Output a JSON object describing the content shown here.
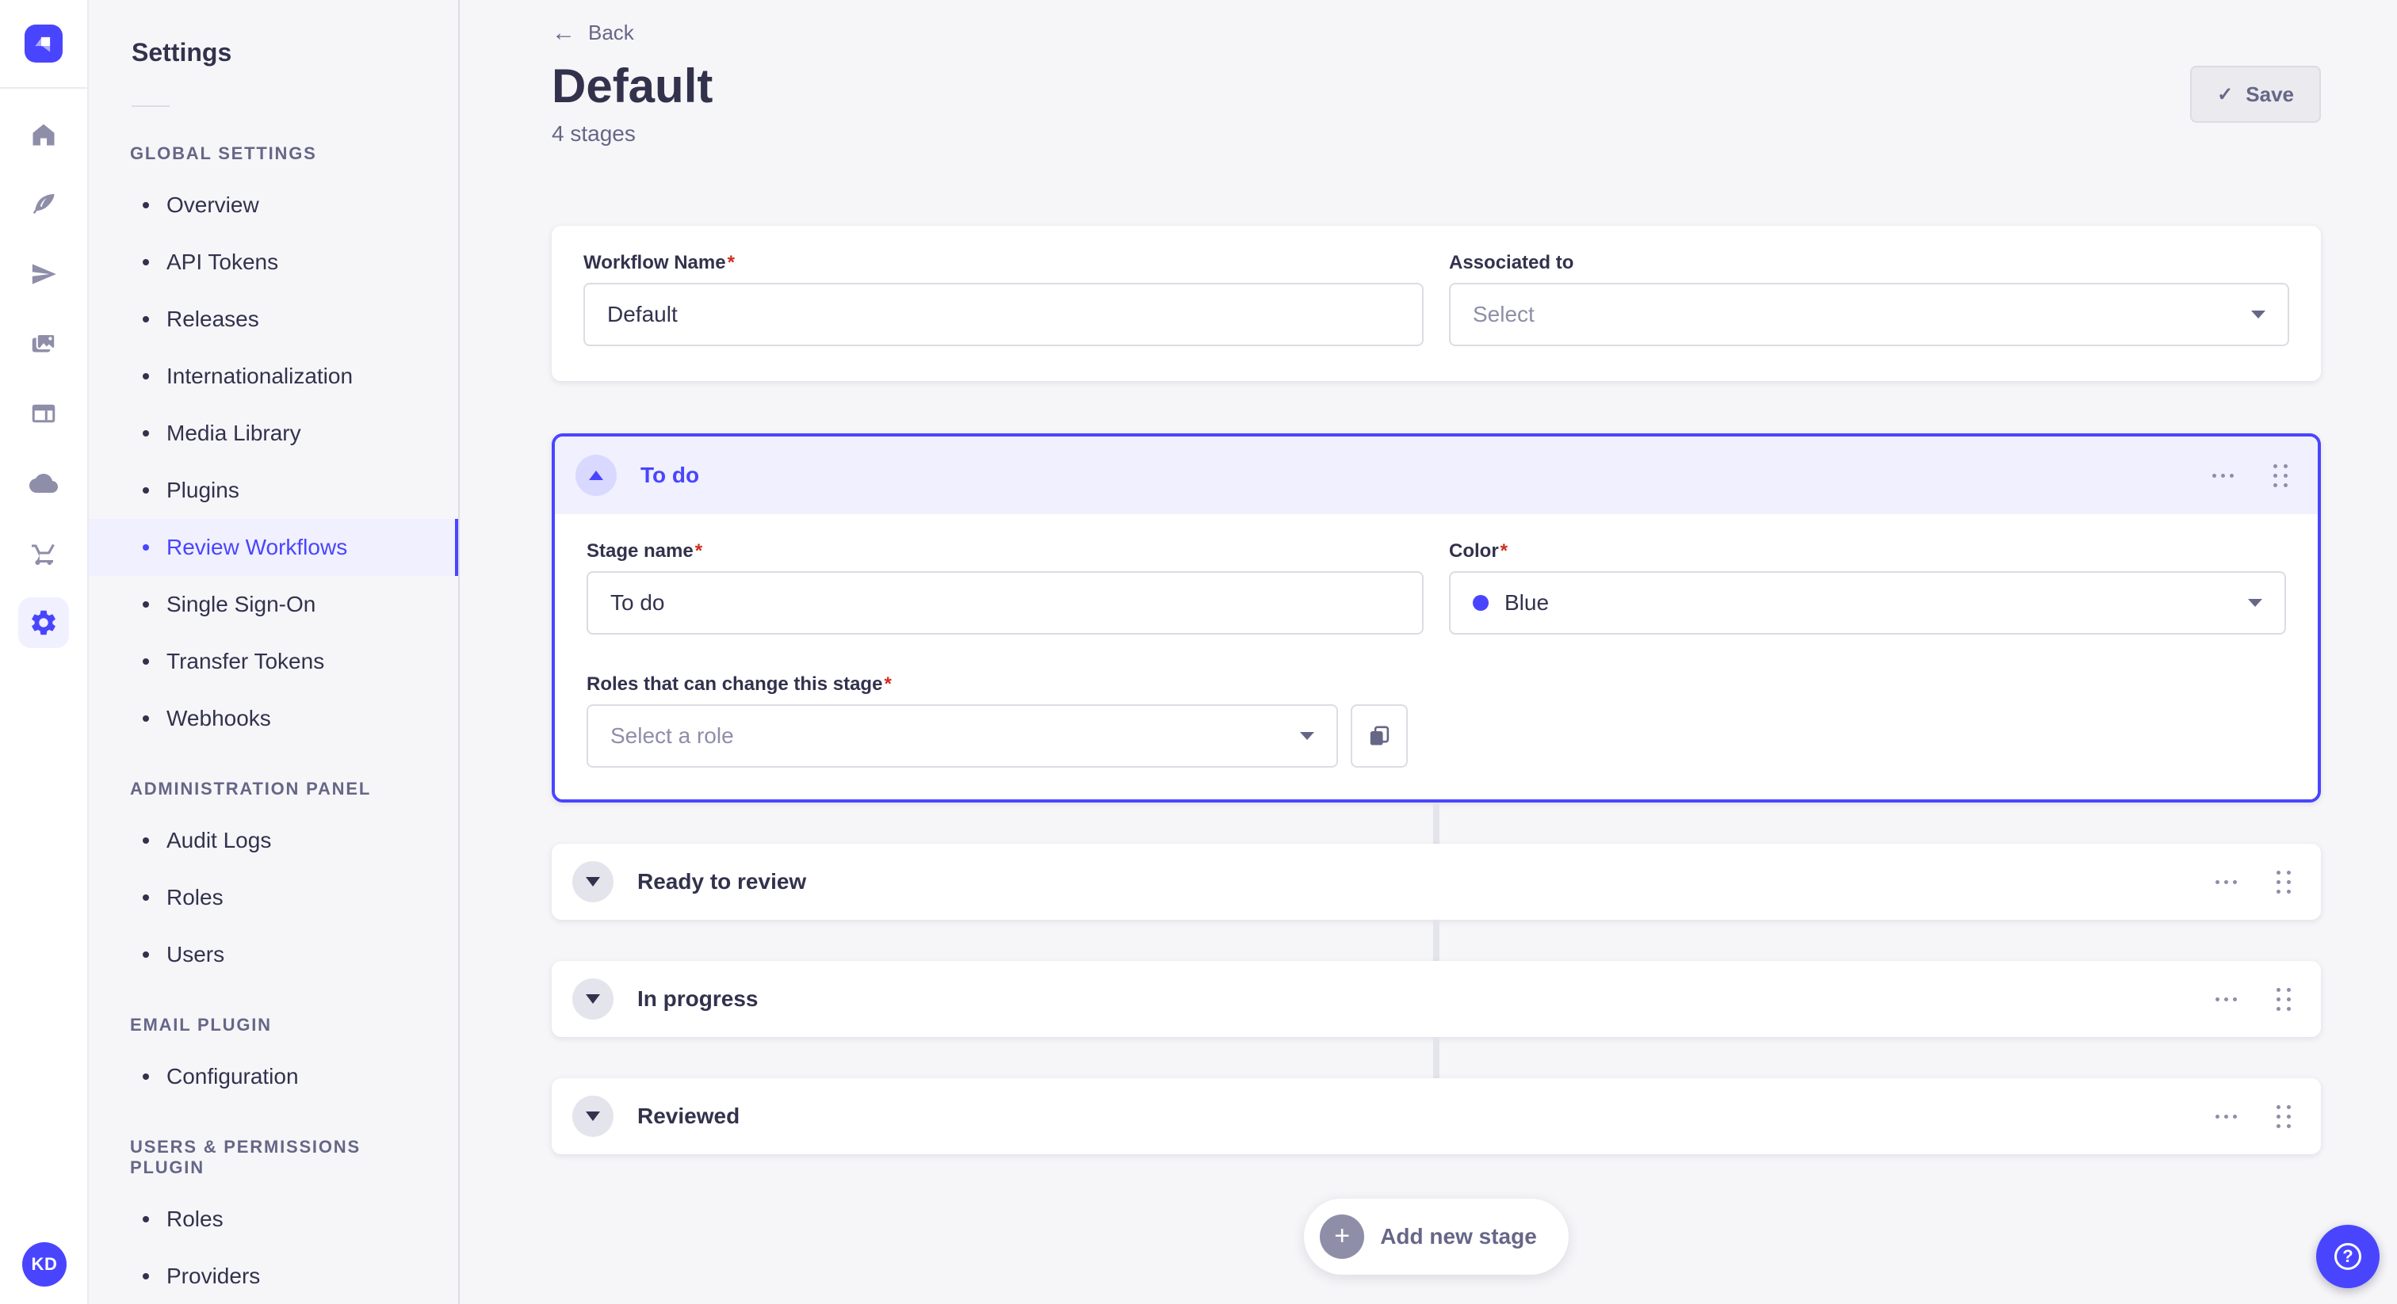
{
  "rail": {
    "icons": [
      "home",
      "content-manager",
      "deploy",
      "media-library",
      "content-type-builder",
      "cloud",
      "marketplace",
      "settings"
    ],
    "active_icon": "settings",
    "avatar_initials": "KD"
  },
  "sidebar": {
    "title": "Settings",
    "sections": [
      {
        "label": "GLOBAL SETTINGS",
        "items": [
          {
            "label": "Overview"
          },
          {
            "label": "API Tokens"
          },
          {
            "label": "Releases"
          },
          {
            "label": "Internationalization"
          },
          {
            "label": "Media Library"
          },
          {
            "label": "Plugins"
          },
          {
            "label": "Review Workflows",
            "active": true
          },
          {
            "label": "Single Sign-On"
          },
          {
            "label": "Transfer Tokens"
          },
          {
            "label": "Webhooks"
          }
        ]
      },
      {
        "label": "ADMINISTRATION PANEL",
        "items": [
          {
            "label": "Audit Logs"
          },
          {
            "label": "Roles"
          },
          {
            "label": "Users"
          }
        ]
      },
      {
        "label": "EMAIL PLUGIN",
        "items": [
          {
            "label": "Configuration"
          }
        ]
      },
      {
        "label": "USERS & PERMISSIONS PLUGIN",
        "items": [
          {
            "label": "Roles"
          },
          {
            "label": "Providers"
          }
        ]
      }
    ]
  },
  "header": {
    "back": "Back",
    "title": "Default",
    "subtitle": "4 stages",
    "save": "Save"
  },
  "workflow_form": {
    "name_label": "Workflow Name",
    "name_required": true,
    "name_value": "Default",
    "associated_label": "Associated to",
    "associated_placeholder": "Select"
  },
  "stage_form": {
    "stage_name_label": "Stage name",
    "color_label": "Color",
    "roles_label": "Roles that can change this stage",
    "roles_placeholder": "Select a role"
  },
  "stages": [
    {
      "name": "To do",
      "expanded": true,
      "stage_name_value": "To do",
      "color_value": "Blue",
      "color_hex": "#4945ff"
    },
    {
      "name": "Ready to review",
      "expanded": false
    },
    {
      "name": "In progress",
      "expanded": false
    },
    {
      "name": "Reviewed",
      "expanded": false
    }
  ],
  "footer": {
    "add_stage": "Add new stage"
  },
  "colors": {
    "primary": "#4945ff",
    "primary_light": "#f0f0ff",
    "required_asterisk": "#d02b20",
    "background": "#f6f6f9",
    "border": "#dcdce4"
  }
}
